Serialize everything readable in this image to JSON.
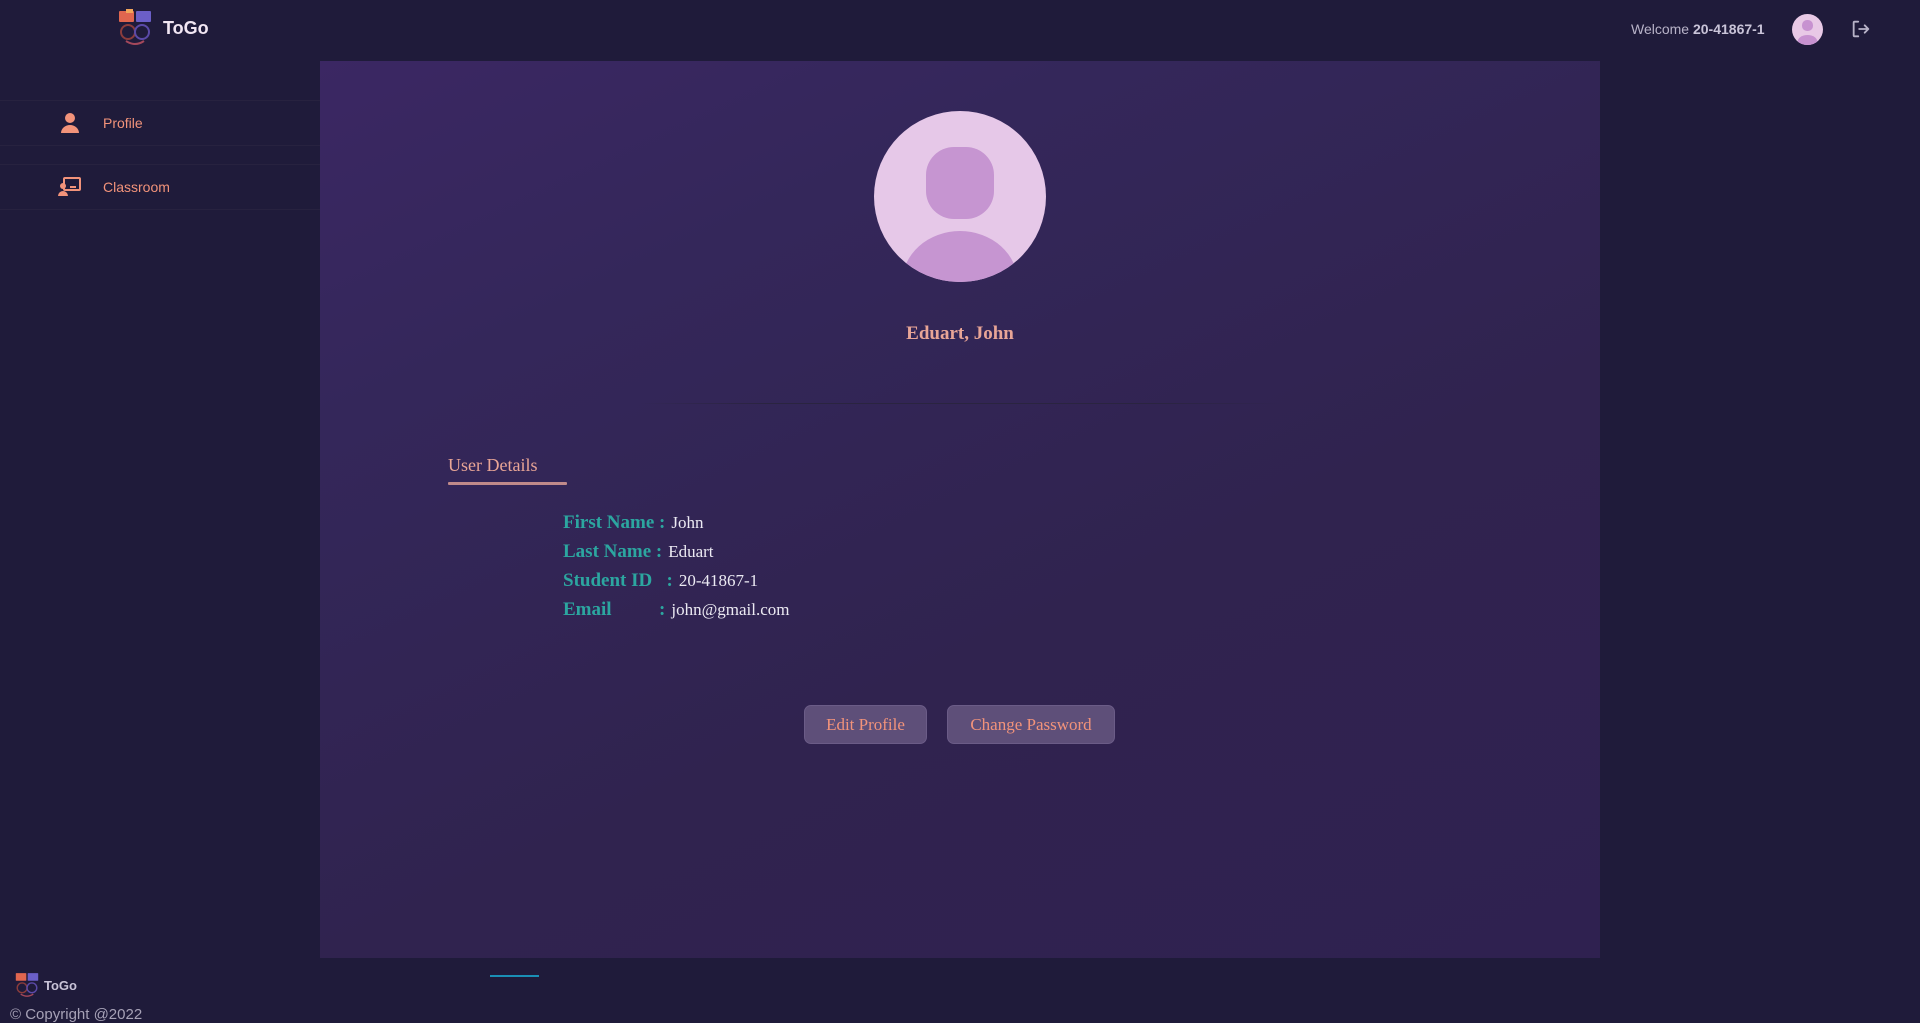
{
  "app": {
    "name": "ToGo",
    "logo_icon": "togo-logo-icon"
  },
  "header": {
    "welcome_label": "Welcome",
    "user_id": "20-41867-1",
    "avatar_icon": "user-avatar-icon",
    "logout_icon": "logout-icon"
  },
  "sidebar": {
    "items": [
      {
        "label": "Profile",
        "icon": "user-icon"
      },
      {
        "label": "Classroom",
        "icon": "classroom-icon"
      }
    ],
    "footer_brand": "ToGo",
    "copyright": "© Copyright @2022"
  },
  "profile": {
    "full_name": "Eduart, John",
    "section_title": "User Details",
    "fields": [
      {
        "key": "First Name :",
        "value": "John"
      },
      {
        "key": "Last Name :",
        "value": "Eduart"
      },
      {
        "key": "Student ID   :",
        "value": "20-41867-1"
      },
      {
        "key": "Email          :",
        "value": "john@gmail.com"
      }
    ],
    "buttons": {
      "edit": "Edit Profile",
      "change_password": "Change Password"
    }
  },
  "colors": {
    "background": "#1f1b3a",
    "panel": "#34275a",
    "accent_text": "#f2937a",
    "name_text": "#e8a596",
    "field_key": "#2ca6a0",
    "button_bg": "#5e4f79",
    "avatar_bg": "#e6c8e8"
  }
}
